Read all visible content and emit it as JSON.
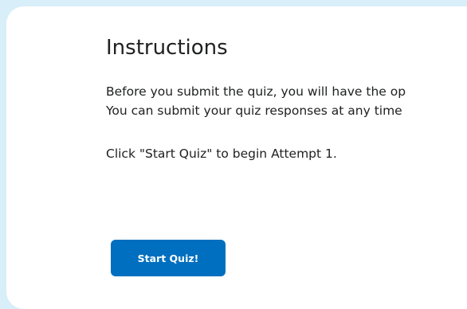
{
  "instructions": {
    "title": "Instructions",
    "lines": [
      "Before you submit the quiz, you will have the op",
      "You can submit your quiz responses at any time"
    ],
    "start_text": "Click \"Start Quiz\" to begin Attempt 1."
  },
  "actions": {
    "start_button_label": "Start Quiz!"
  },
  "colors": {
    "background": "#d8eef9",
    "card": "#ffffff",
    "text": "#202122",
    "primary_button": "#006fbf",
    "button_text": "#ffffff"
  }
}
